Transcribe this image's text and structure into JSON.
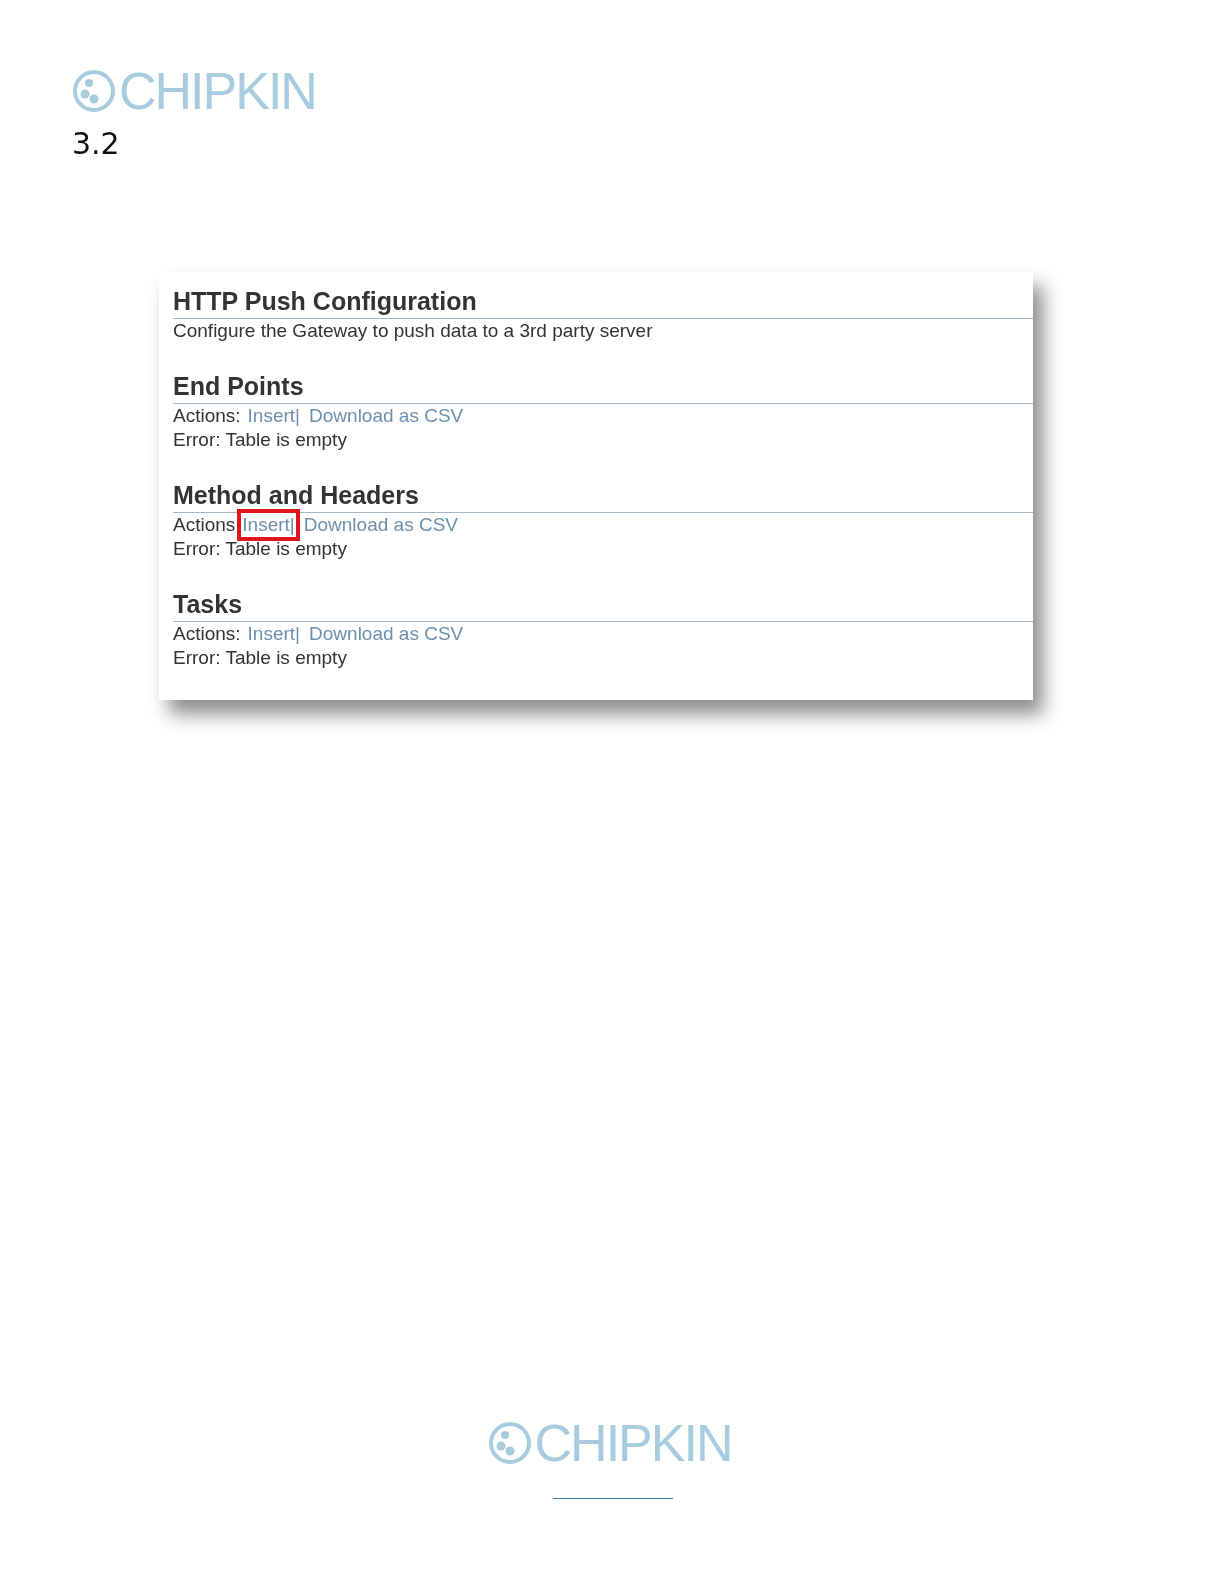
{
  "header": {
    "logo": "CHIPKIN",
    "section_number": "3.2"
  },
  "screenshot": {
    "title": "HTTP Push Configuration",
    "description": "Configure the Gateway to push data to a 3rd party server",
    "sections": [
      {
        "heading": "End Points",
        "actions_label": "Actions:",
        "insert": "Insert|",
        "insert_highlighted": false,
        "download": "Download as CSV",
        "error": "Error: Table is empty"
      },
      {
        "heading": "Method and Headers",
        "actions_label": "Actions",
        "insert": "Insert|",
        "insert_highlighted": true,
        "download": "Download as CSV",
        "error": "Error: Table is empty"
      },
      {
        "heading": "Tasks",
        "actions_label": "Actions:",
        "insert": "Insert|",
        "insert_highlighted": false,
        "download": "Download as CSV",
        "error": "Error: Table is empty"
      }
    ]
  },
  "footer": {
    "logo": "CHIPKIN"
  }
}
